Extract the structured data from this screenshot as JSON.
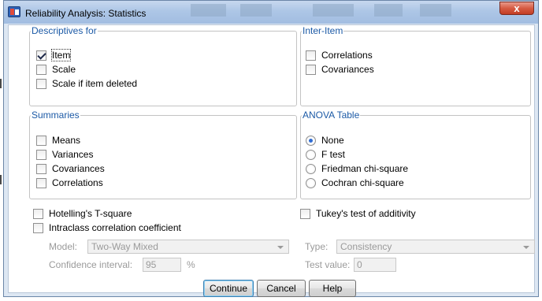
{
  "window": {
    "title": "Reliability Analysis: Statistics",
    "close_glyph": "x"
  },
  "descriptives": {
    "legend": "Descriptives for",
    "items": [
      {
        "label": "Item",
        "checked": true
      },
      {
        "label": "Scale",
        "checked": false
      },
      {
        "label": "Scale if item deleted",
        "checked": false
      }
    ]
  },
  "inter_item": {
    "legend": "Inter-Item",
    "items": [
      {
        "label": "Correlations",
        "checked": false
      },
      {
        "label": "Covariances",
        "checked": false
      }
    ]
  },
  "summaries": {
    "legend": "Summaries",
    "items": [
      {
        "label": "Means",
        "checked": false
      },
      {
        "label": "Variances",
        "checked": false
      },
      {
        "label": "Covariances",
        "checked": false
      },
      {
        "label": "Correlations",
        "checked": false
      }
    ]
  },
  "anova": {
    "legend": "ANOVA Table",
    "options": [
      {
        "label": "None",
        "selected": true
      },
      {
        "label": "F test",
        "selected": false
      },
      {
        "label": "Friedman chi-square",
        "selected": false
      },
      {
        "label": "Cochran chi-square",
        "selected": false
      }
    ]
  },
  "extra": {
    "hotelling": {
      "label": "Hotelling's T-square",
      "checked": false
    },
    "tukey": {
      "label": "Tukey's test of additivity",
      "checked": false
    },
    "icc": {
      "label": "Intraclass correlation coefficient",
      "checked": false
    }
  },
  "icc_settings": {
    "model_label": "Model:",
    "model_value": "Two-Way Mixed",
    "type_label": "Type:",
    "type_value": "Consistency",
    "ci_label": "Confidence interval:",
    "ci_value": "95",
    "ci_unit": "%",
    "test_value_label": "Test value:",
    "test_value": "0"
  },
  "buttons": {
    "continue": "Continue",
    "cancel": "Cancel",
    "help": "Help"
  },
  "colors": {
    "legend_text": "#1c5aa6",
    "radio_dot": "#2f6cd3",
    "close_button": "#c23d24",
    "disabled_text": "#9a9a9a"
  }
}
